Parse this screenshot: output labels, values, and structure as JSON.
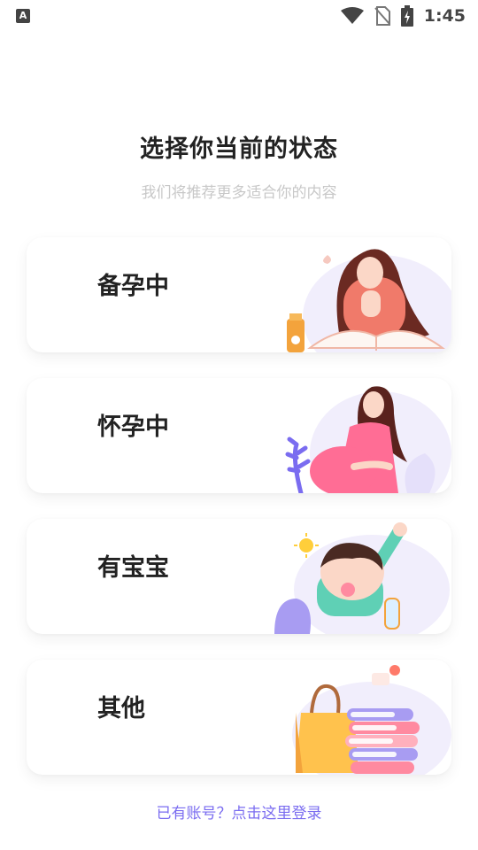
{
  "status_bar": {
    "app_glyph": "A",
    "time": "1:45",
    "icons": [
      "wifi-icon",
      "no-sim-icon",
      "battery-charging-icon"
    ]
  },
  "header": {
    "title": "选择你当前的状态",
    "subtitle": "我们将推荐更多适合你的内容"
  },
  "options": [
    {
      "label": "备孕中",
      "icon": "woman-reading-illustration"
    },
    {
      "label": "怀孕中",
      "icon": "pregnant-woman-illustration"
    },
    {
      "label": "有宝宝",
      "icon": "baby-illustration"
    },
    {
      "label": "其他",
      "icon": "shopping-bag-books-illustration"
    }
  ],
  "footer": {
    "login_link": "已有账号？点击这里登录"
  },
  "colors": {
    "accent": "#7a6cf0",
    "title": "#222222",
    "subtitle": "#c8c8c8"
  }
}
